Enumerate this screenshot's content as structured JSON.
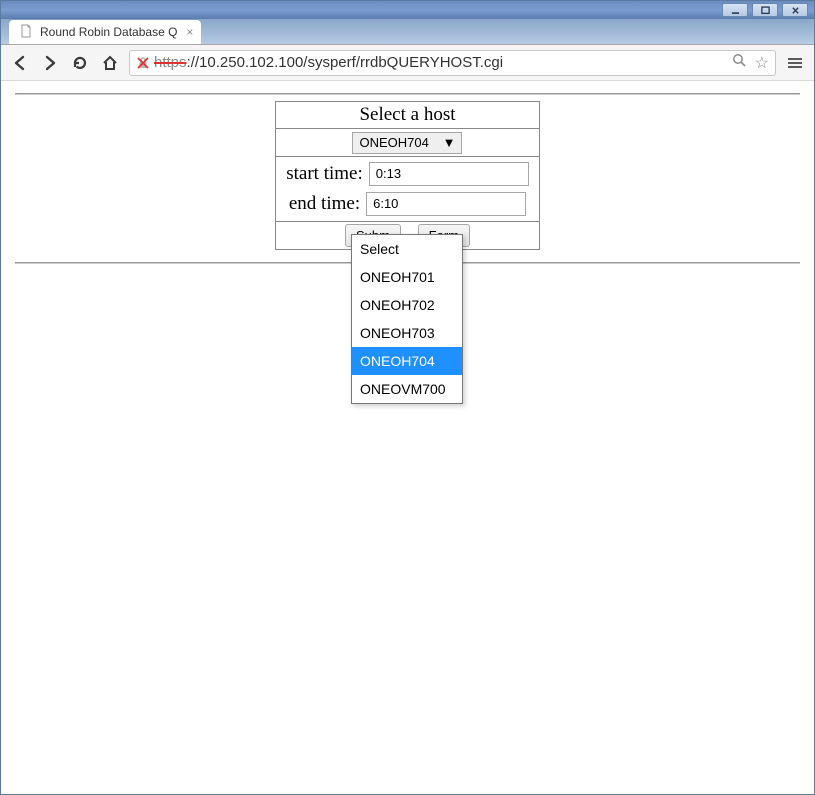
{
  "window": {
    "tab_title": "Round Robin Database Q"
  },
  "toolbar": {
    "url_scheme_struck": "https",
    "url_rest": "://10.250.102.100/sysperf/rrdbQUERYHOST.cgi"
  },
  "form": {
    "title": "Select a host",
    "host_select": {
      "selected": "ONEOH704",
      "options": [
        "Select",
        "ONEOH701",
        "ONEOH702",
        "ONEOH703",
        "ONEOH704",
        "ONEOVM700"
      ],
      "highlighted": "ONEOH704"
    },
    "start_time_label": "start time:",
    "start_time_value": "0:13",
    "end_time_label": "end time:",
    "end_time_value": "6:10",
    "submit_btn": "Subm",
    "reset_btn": "Form"
  }
}
